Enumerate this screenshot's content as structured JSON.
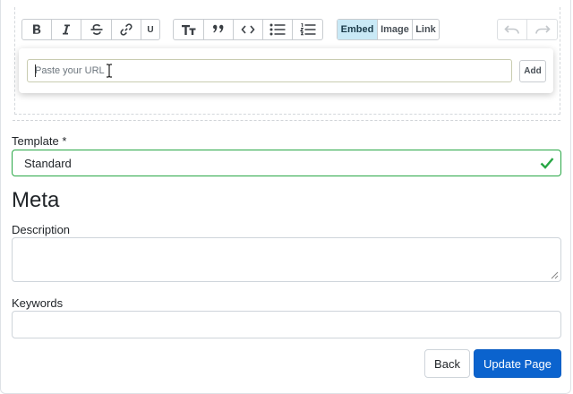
{
  "toolbar": {
    "underline_label": "U",
    "embed_tab": "Embed",
    "image_tab": "Image",
    "link_tab": "Link"
  },
  "embed": {
    "url_placeholder": "Paste your URL",
    "add_label": "Add"
  },
  "form": {
    "template_label": "Template *",
    "template_value": "Standard",
    "meta_heading": "Meta",
    "description_label": "Description",
    "keywords_label": "Keywords"
  },
  "actions": {
    "back_label": "Back",
    "update_label": "Update Page"
  },
  "colors": {
    "primary": "#0b63ce",
    "valid": "#28a745",
    "active_tab": "#c9e9f6"
  }
}
